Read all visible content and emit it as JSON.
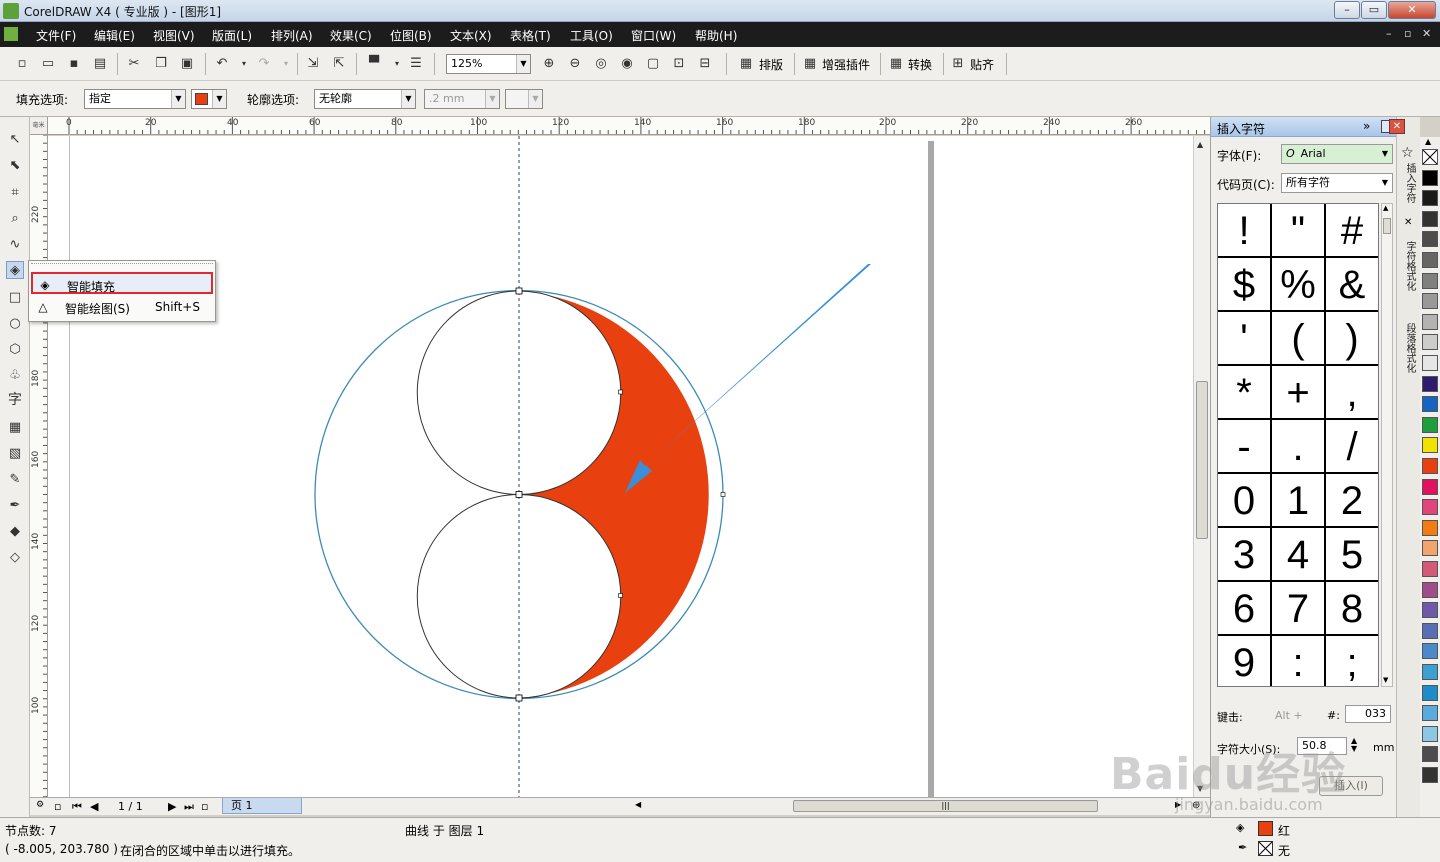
{
  "window": {
    "title": "CorelDRAW X4 ( 专业版 ) - [图形1]",
    "min": "–",
    "max": "▭",
    "close": "✕"
  },
  "menu": {
    "items": [
      "文件(F)",
      "编辑(E)",
      "视图(V)",
      "版面(L)",
      "排列(A)",
      "效果(C)",
      "位图(B)",
      "文本(X)",
      "表格(T)",
      "工具(O)",
      "窗口(W)",
      "帮助(H)"
    ],
    "mdi_min": "–",
    "mdi_restore": "▫",
    "mdi_close": "✕"
  },
  "toolbar": {
    "zoom": "125%",
    "buttons": [
      "排版",
      "增强插件",
      "转换",
      "贴齐"
    ]
  },
  "property_bar": {
    "fill_label": "填充选项:",
    "fill_value": "指定",
    "fill_color": "#e8410f",
    "outline_label": "轮廓选项:",
    "outline_value": "无轮廓",
    "outline_width": ".2 mm"
  },
  "flyout": {
    "smart_fill": "智能填充",
    "smart_draw": "智能绘图(S)",
    "smart_draw_shortcut": "Shift+S"
  },
  "ruler": {
    "h_labels": [
      "0",
      "20",
      "40",
      "60",
      "80",
      "100",
      "120",
      "140",
      "160",
      "180",
      "200",
      "220",
      "240",
      "260"
    ],
    "v_labels": [
      "220",
      "200",
      "180",
      "160",
      "140",
      "120",
      "100"
    ],
    "unit": "毫米"
  },
  "drawing": {
    "fill_color": "#e8410f",
    "arrow_color": "#3b8fd9"
  },
  "pagebar": {
    "page_counter": "1 / 1",
    "page_tab": "页 1"
  },
  "docker": {
    "title": "插入字符",
    "font_label": "字体(F):",
    "font_value": "Arial",
    "codepage_label": "代码页(C):",
    "codepage_value": "所有字符",
    "chars": [
      "!",
      "\"",
      "#",
      "$",
      "%",
      "&",
      "'",
      "(",
      ")",
      "*",
      "+",
      ",",
      "-",
      ".",
      "/",
      "0",
      "1",
      "2",
      "3",
      "4",
      "5",
      "6",
      "7",
      "8",
      "9",
      ":",
      ";"
    ],
    "keystroke_label": "键击:",
    "keystroke_value": "Alt +",
    "hash_label": "#:",
    "hash_value": "033",
    "size_label": "字符大小(S):",
    "size_value": "50.8",
    "size_unit": "mm",
    "insert_button": "插入(I)"
  },
  "side_tabs": [
    "插入字符",
    "字符格式化",
    "段落格式化"
  ],
  "palette": [
    "#ffffff",
    "#000000",
    "#1a1a1a",
    "#333333",
    "#4d4d4d",
    "#666666",
    "#808080",
    "#999999",
    "#b3b3b3",
    "#cccccc",
    "#e6e6e6",
    "#2e1a6e",
    "#1565c0",
    "#1e9e3c",
    "#f2e200",
    "#e8410f",
    "#e0115f",
    "#e0457b",
    "#f07c12",
    "#f2a46e",
    "#d45a7a",
    "#a04d8c",
    "#6e5aa8",
    "#5a6eb4",
    "#4d88c8",
    "#3ca0d2",
    "#1e8cc8",
    "#5aaadc",
    "#8cc8e6",
    "#4d4d4d",
    "#333333"
  ],
  "status": {
    "nodes": "节点数: 7",
    "object": "曲线 于 图层 1",
    "coords": "( -8.005, 203.780 )",
    "hint": "在闭合的区域中单击以进行填充。",
    "fill_name": "红",
    "outline_name": "无"
  },
  "watermark": {
    "text": "Baidu经验",
    "sub": "jingyan.baidu.com"
  }
}
